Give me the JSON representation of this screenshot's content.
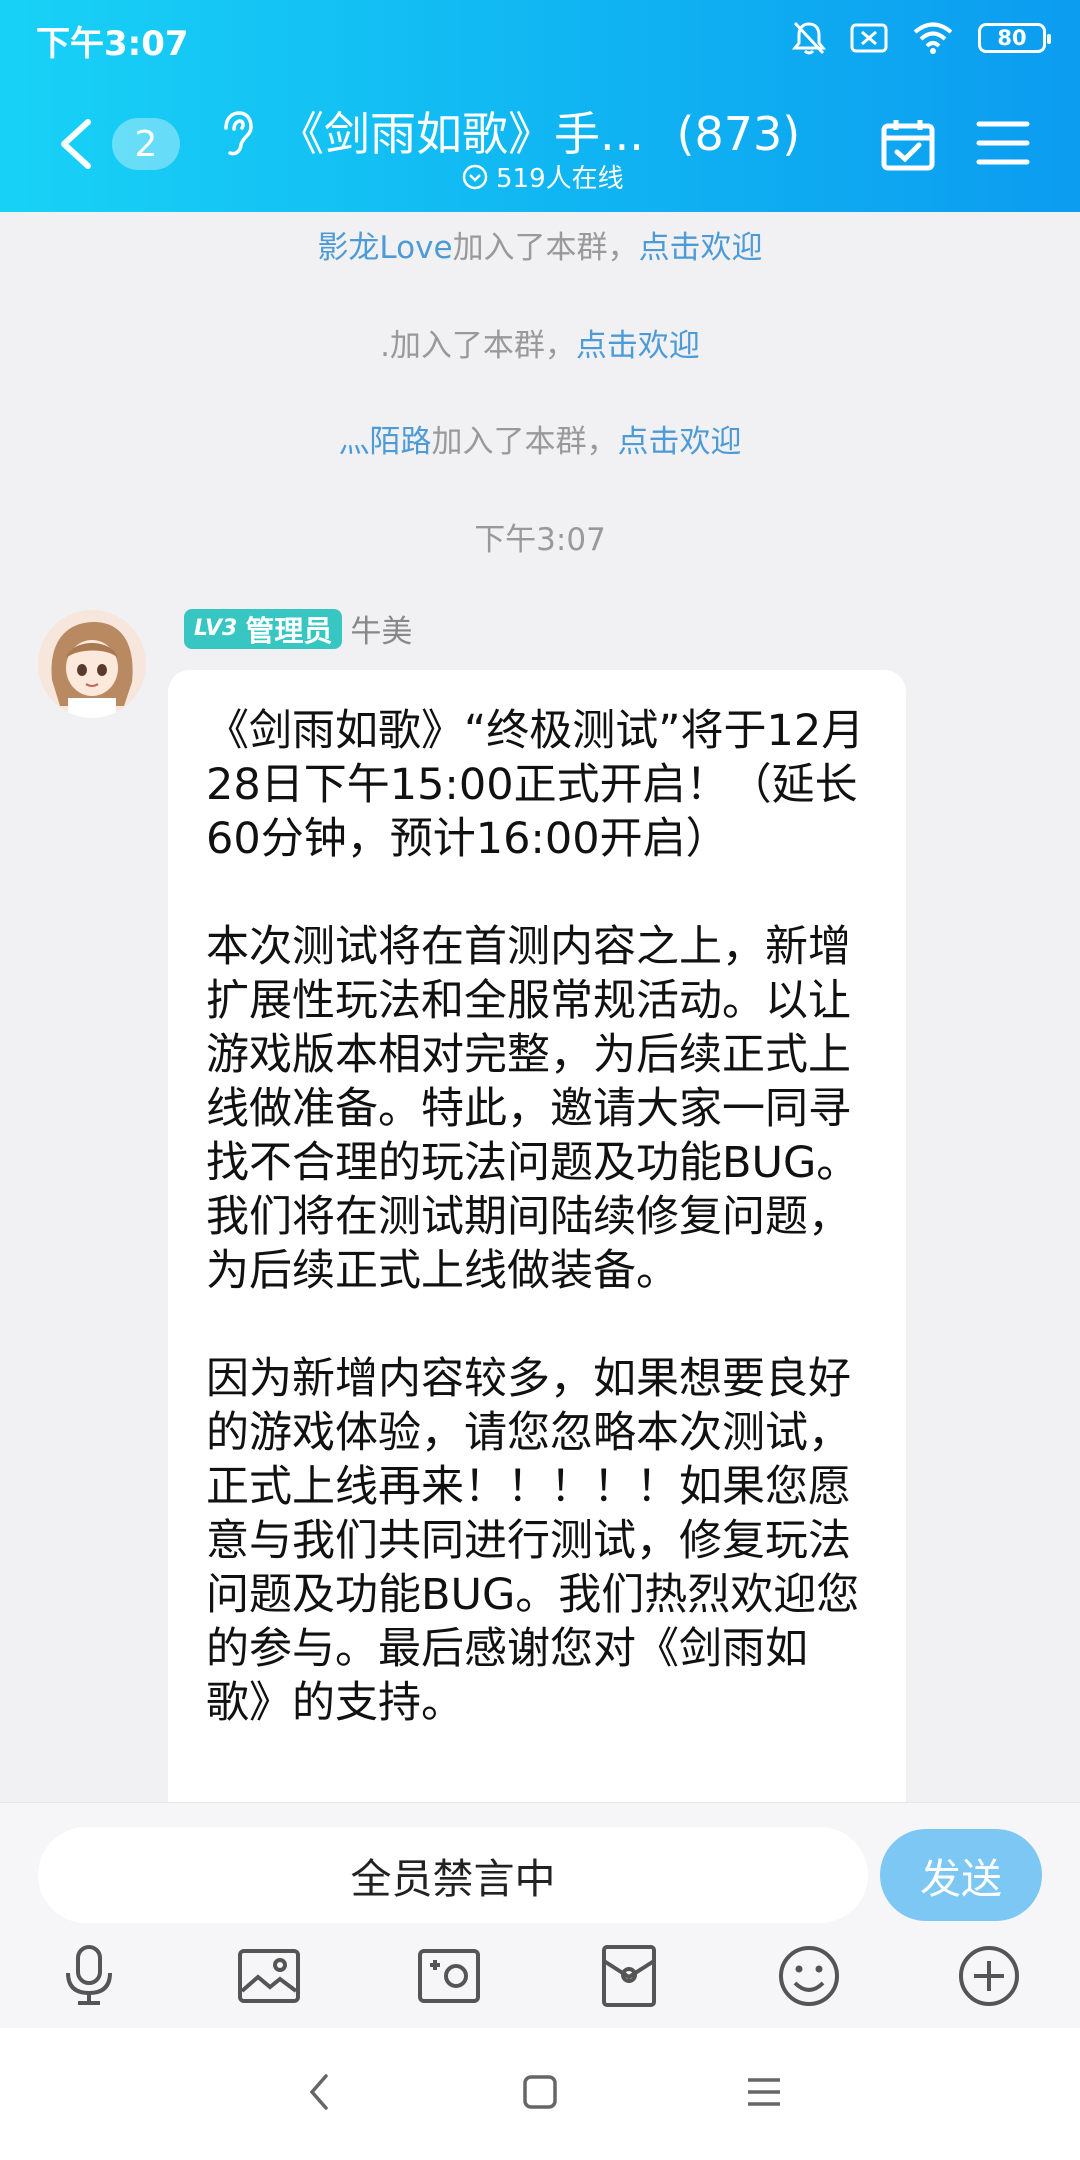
{
  "status_bar": {
    "time": "下午3:07",
    "battery": "80",
    "icons": [
      "bell-muted-icon",
      "sim-off-icon",
      "wifi-icon",
      "battery-icon"
    ]
  },
  "header": {
    "unread_count": "2",
    "title": "《剑雨如歌》手...",
    "member_count": "(873)",
    "online_text": "519人在线",
    "colors": {
      "gradient_start": "#18d2f6",
      "gradient_end": "#0c9cf0"
    }
  },
  "system_messages": [
    {
      "name": "影龙Love",
      "text": "加入了本群，",
      "link": "点击欢迎"
    },
    {
      "name": "",
      "text": ".加入了本群，",
      "link": "点击欢迎"
    },
    {
      "name": "灬陌路",
      "text": "加入了本群，",
      "link": "点击欢迎"
    }
  ],
  "time_divider": "下午3:07",
  "message": {
    "level": "LV3",
    "role": "管理员",
    "sender": "牛美",
    "paragraphs": [
      "《剑雨如歌》“终极测试”将于12月28日下午15:00正式开启！（延长60分钟，预计16:00开启）",
      "本次测试将在首测内容之上，新增扩展性玩法和全服常规活动。以让游戏版本相对完整，为后续正式上线做准备。特此，邀请大家一同寻找不合理的玩法问题及功能BUG。我们将在测试期间陆续修复问题，为后续正式上线做装备。",
      "因为新增内容较多，如果想要良好的游戏体验，请您忽略本次测试，正式上线再来！！！！！如果您愿意与我们共同进行测试，修复玩法问题及功能BUG。我们热烈欢迎您的参与。最后感谢您对《剑雨如歌》的支持。"
    ]
  },
  "input": {
    "muted_text": "全员禁言中",
    "send_label": "发送",
    "send_color": "#7cc7f4"
  },
  "toolbar_icons": [
    "microphone-icon",
    "image-icon",
    "camera-icon",
    "red-packet-icon",
    "emoji-icon",
    "plus-icon"
  ],
  "system_nav_icons": [
    "nav-back-icon",
    "nav-home-icon",
    "nav-menu-icon"
  ]
}
